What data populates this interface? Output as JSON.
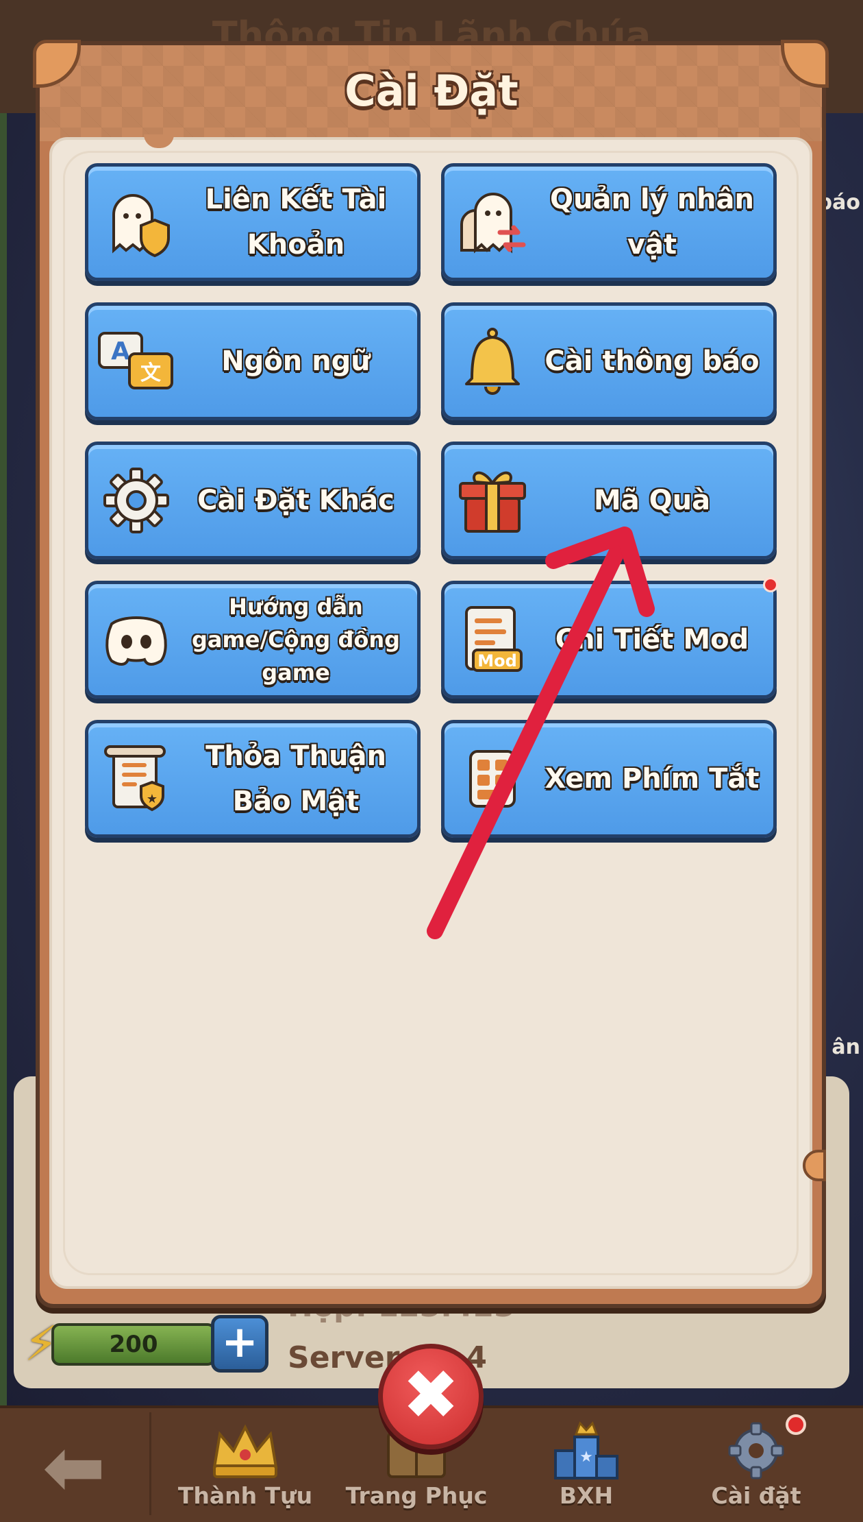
{
  "background": {
    "title": "Thông Tin Lãnh Chúa",
    "right_texts": [
      "báo",
      "ân"
    ],
    "energy_value": "200",
    "profile_line_1": "Hợp: 123.423",
    "server_label": "Server: 1..4"
  },
  "dialog": {
    "title": "Cài Đặt",
    "buttons": [
      {
        "label": "Liên Kết Tài Khoản",
        "icon": "ghost-shield-icon"
      },
      {
        "label": "Quản lý nhân vật",
        "icon": "ghost-swap-icon"
      },
      {
        "label": "Ngôn ngữ",
        "icon": "translate-icon"
      },
      {
        "label": "Cài thông báo",
        "icon": "bell-icon"
      },
      {
        "label": "Cài Đặt Khác",
        "icon": "gear-icon"
      },
      {
        "label": "Mã Quà",
        "icon": "gift-icon"
      },
      {
        "label": "Hướng dẫn game/Cộng đồng game",
        "icon": "discord-icon"
      },
      {
        "label": "Chi Tiết Mod",
        "icon": "mod-document-icon",
        "mod_tag": "Mod"
      },
      {
        "label": "Thỏa Thuận Bảo Mật",
        "icon": "privacy-scroll-icon"
      },
      {
        "label": "Xem Phím Tắt",
        "icon": "keyboard-icon"
      }
    ]
  },
  "close_button": {
    "symbol": "✖"
  },
  "bottom_nav": {
    "back_symbol": "⬅",
    "items": [
      {
        "label": "Thành Tựu",
        "icon": "crown-icon"
      },
      {
        "label": "Trang Phục",
        "icon": "wardrobe-icon"
      },
      {
        "label": "BXH",
        "icon": "podium-icon"
      },
      {
        "label": "Cài đặt",
        "icon": "gear-icon"
      }
    ]
  },
  "colors": {
    "button_blue": "#57a5ef",
    "frame_brown": "#bf7a51",
    "annotation_red": "#e0213e",
    "close_red": "#d93a3a"
  }
}
